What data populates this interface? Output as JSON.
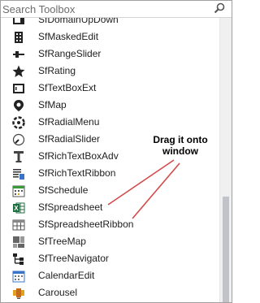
{
  "search": {
    "placeholder": "Search Toolbox"
  },
  "items": [
    {
      "label": "SfDomainUpDown",
      "icon": "domain-updown-icon"
    },
    {
      "label": "SfMaskedEdit",
      "icon": "masked-edit-icon"
    },
    {
      "label": "SfRangeSlider",
      "icon": "range-slider-icon"
    },
    {
      "label": "SfRating",
      "icon": "star-icon"
    },
    {
      "label": "SfTextBoxExt",
      "icon": "textbox-icon"
    },
    {
      "label": "SfMap",
      "icon": "map-pin-icon"
    },
    {
      "label": "SfRadialMenu",
      "icon": "radial-menu-icon"
    },
    {
      "label": "SfRadialSlider",
      "icon": "radial-slider-icon"
    },
    {
      "label": "SfRichTextBoxAdv",
      "icon": "rich-text-icon"
    },
    {
      "label": "SfRichTextRibbon",
      "icon": "text-ribbon-icon"
    },
    {
      "label": "SfSchedule",
      "icon": "schedule-icon"
    },
    {
      "label": "SfSpreadsheet",
      "icon": "spreadsheet-icon"
    },
    {
      "label": "SfSpreadsheetRibbon",
      "icon": "spreadsheet-ribbon-icon"
    },
    {
      "label": "SfTreeMap",
      "icon": "tree-map-icon"
    },
    {
      "label": "SfTreeNavigator",
      "icon": "tree-navigator-icon"
    },
    {
      "label": "CalendarEdit",
      "icon": "calendar-edit-icon"
    },
    {
      "label": "Carousel",
      "icon": "carousel-icon"
    }
  ],
  "annotation": {
    "text": "Drag it onto window"
  },
  "colors": {
    "arrow": "#d24a4a",
    "text": "#1e1e1e"
  }
}
